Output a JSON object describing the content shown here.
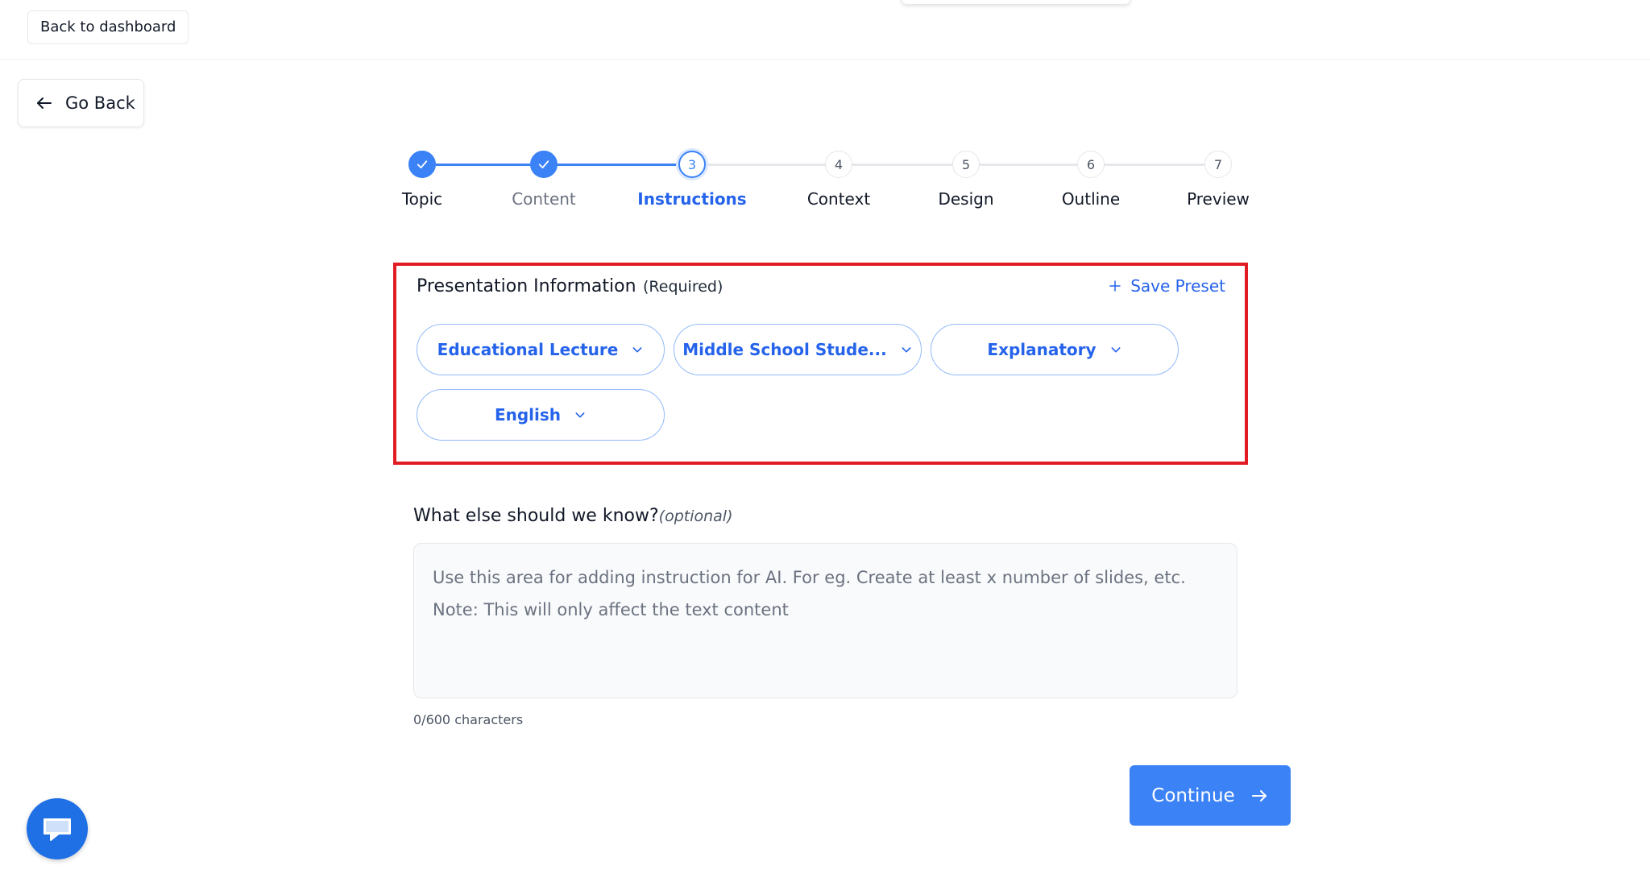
{
  "top_bar": {
    "back_to_dashboard": "Back to dashboard"
  },
  "nav": {
    "go_back": "Go Back"
  },
  "stepper": {
    "current_step": 3,
    "steps": [
      {
        "number": "1",
        "label": "Topic",
        "state": "completed"
      },
      {
        "number": "2",
        "label": "Content",
        "state": "completed"
      },
      {
        "number": "3",
        "label": "Instructions",
        "state": "current"
      },
      {
        "number": "4",
        "label": "Context",
        "state": "upcoming"
      },
      {
        "number": "5",
        "label": "Design",
        "state": "upcoming"
      },
      {
        "number": "6",
        "label": "Outline",
        "state": "upcoming"
      },
      {
        "number": "7",
        "label": "Preview",
        "state": "upcoming"
      }
    ]
  },
  "presentation_info": {
    "title": "Presentation Information",
    "required_label": "(Required)",
    "save_preset_label": "Save Preset",
    "selectors": [
      {
        "name": "presentation-type",
        "value": "Educational Lecture"
      },
      {
        "name": "audience",
        "value": "Middle School Stude..."
      },
      {
        "name": "tone",
        "value": "Explanatory"
      },
      {
        "name": "language",
        "value": "English"
      }
    ]
  },
  "instructions": {
    "label": "What else should we know?",
    "optional_label": "(optional)",
    "value": "",
    "placeholder": "Use this area for adding instruction for AI. For eg. Create at least x number of slides, etc.\nNote: This will only affect the text content",
    "char_count": "0/600 characters"
  },
  "actions": {
    "continue_label": "Continue"
  },
  "icons": {
    "go_back": "arrow-left-icon",
    "step_done": "check-icon",
    "save_preset": "plus-icon",
    "selector": "chevron-down-icon",
    "continue": "arrow-right-icon",
    "chat": "chat-icon"
  },
  "colors": {
    "accent": "#3b82f6",
    "accent_text": "#2563eb",
    "highlight_border": "#e11d23",
    "chat_button": "#1f6fe5"
  }
}
